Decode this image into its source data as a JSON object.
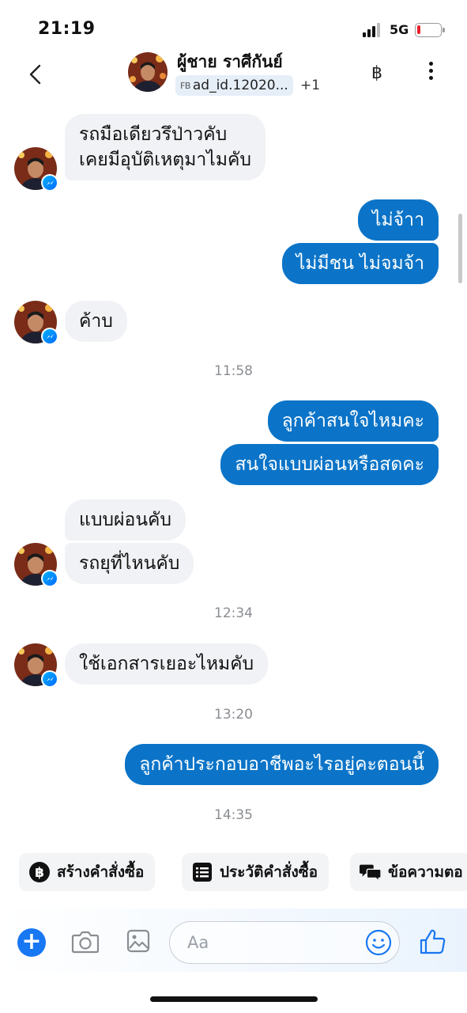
{
  "status_bar": {
    "time": "21:19",
    "network": "5G",
    "battery_level": 0.15,
    "signal_bars_active": 3
  },
  "header": {
    "contact_name": "ผู้ชาย ราศีกันย์",
    "ad_tag": "FB",
    "ad_id": "ad_id.12020...",
    "ad_extra": "+1",
    "currency_icon": "baht-icon"
  },
  "messages": [
    {
      "dir": "in",
      "text": "รถมือเดียวรึป่าวคับ"
    },
    {
      "dir": "in",
      "text": "เคยมีอุบัติเหตุมาไมคับ"
    },
    {
      "dir": "out",
      "text": "ไม่จ้าา"
    },
    {
      "dir": "out",
      "text": "ไม่มีชน ไม่จมจ้า"
    },
    {
      "dir": "in",
      "text": "ค้าบ"
    },
    {
      "dir": "out",
      "text": "ลูกค้าสนใจไหมคะ"
    },
    {
      "dir": "out",
      "text": "สนใจแบบผ่อนหรือสดคะ"
    },
    {
      "dir": "in",
      "text": "แบบผ่อนคับ"
    },
    {
      "dir": "in",
      "text": "รถยุที่ไหนคับ"
    },
    {
      "dir": "in",
      "text": "ใช้เอกสารเยอะไหมคับ"
    },
    {
      "dir": "out",
      "text": "ลูกค้าประกอบอาชีพอะไรอยู่คะตอนนี้"
    }
  ],
  "timestamps": [
    "11:58",
    "12:34",
    "13:20",
    "14:35"
  ],
  "quick_actions": [
    {
      "label": "สร้างคำสั่งซื้อ",
      "icon": "baht-circle-icon"
    },
    {
      "label": "ประวัติคำสั่งซื้อ",
      "icon": "order-list-icon"
    },
    {
      "label": "ข้อความตอ",
      "icon": "chat-bubbles-icon"
    }
  ],
  "composer": {
    "placeholder": "Aa"
  },
  "colors": {
    "outgoing_bubble": "#0b74c8",
    "incoming_bubble": "#f1f2f5",
    "accent": "#1877f2"
  }
}
